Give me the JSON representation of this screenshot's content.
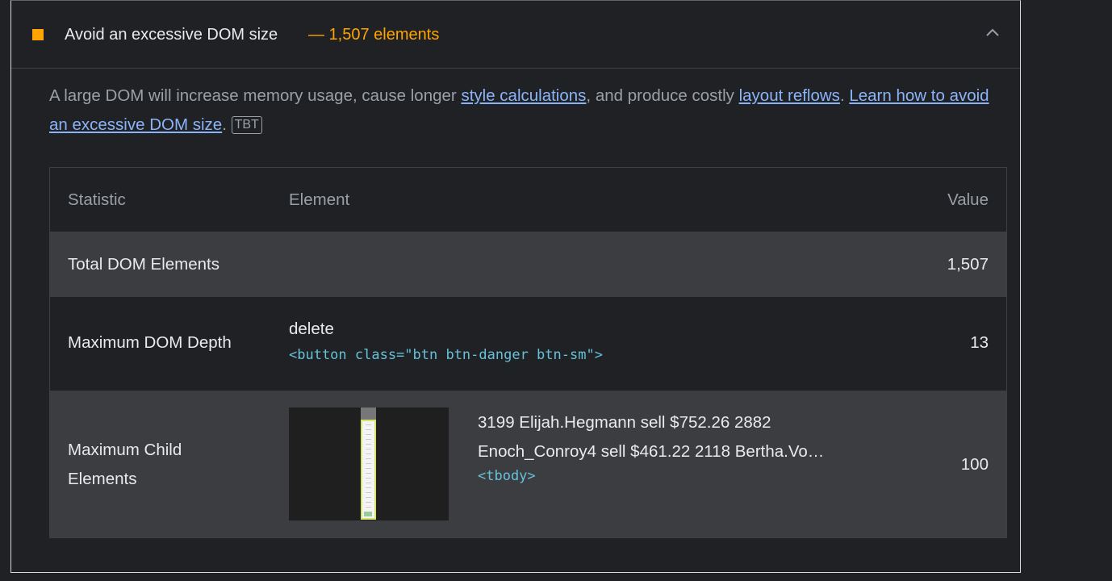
{
  "audit": {
    "title": "Avoid an excessive DOM size",
    "display_value": "— 1,507 elements",
    "status_color": "#ffa400",
    "expand_icon": "chevron-up-icon"
  },
  "description": {
    "text_1": "A large DOM will increase memory usage, cause longer ",
    "link_1": "style calculations",
    "text_2": ", and produce costly ",
    "link_2": "layout reflows",
    "text_3": ". ",
    "link_3": "Learn how to avoid an excessive DOM size",
    "text_4": ".",
    "tag": "TBT"
  },
  "table": {
    "headers": {
      "statistic": "Statistic",
      "element": "Element",
      "value": "Value"
    },
    "rows": [
      {
        "statistic": "Total DOM Elements",
        "element_snippet": "",
        "element_selector": "",
        "value": "1,507"
      },
      {
        "statistic": "Maximum DOM Depth",
        "element_snippet": "delete",
        "element_selector": "<button class=\"btn btn-danger btn-sm\">",
        "value": "13"
      },
      {
        "statistic": "Maximum Child Elements",
        "element_snippet": "3199 Elijah.Hegmann sell $752.26 2882 Enoch_Conroy4 sell $461.22 2118 Bertha.Vo…",
        "element_selector": "<tbody>",
        "value": "100"
      }
    ]
  },
  "colors": {
    "background": "#202124",
    "link": "#8ab4f8",
    "selector": "#66c2d9",
    "warning": "#ffa400"
  }
}
